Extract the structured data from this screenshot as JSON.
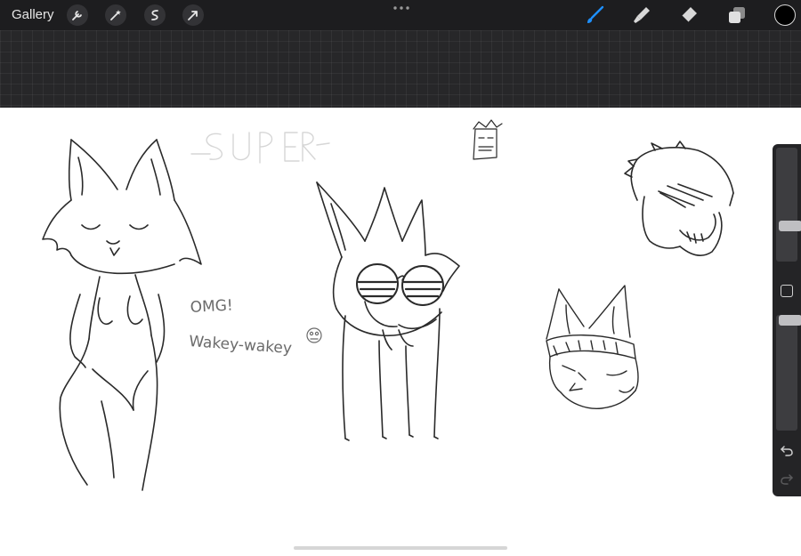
{
  "toolbar": {
    "gallery_label": "Gallery",
    "actions": [
      "wrench-icon",
      "magic-wand-icon",
      "selection-icon",
      "transform-arrow-icon"
    ],
    "tools": [
      "brush-icon",
      "smudge-icon",
      "eraser-icon",
      "layers-icon"
    ],
    "active_tool": "brush-icon",
    "active_color": "#1e90ff",
    "current_color": "#000000"
  },
  "canvas": {
    "notes": [
      "OMG!",
      "Wakey-wakey"
    ],
    "faint_text": "SUPER"
  },
  "sidebar": {
    "brush_size": 0.29,
    "opacity": 1.0,
    "undo_icon": "undo-icon",
    "redo_icon": "redo-icon"
  }
}
